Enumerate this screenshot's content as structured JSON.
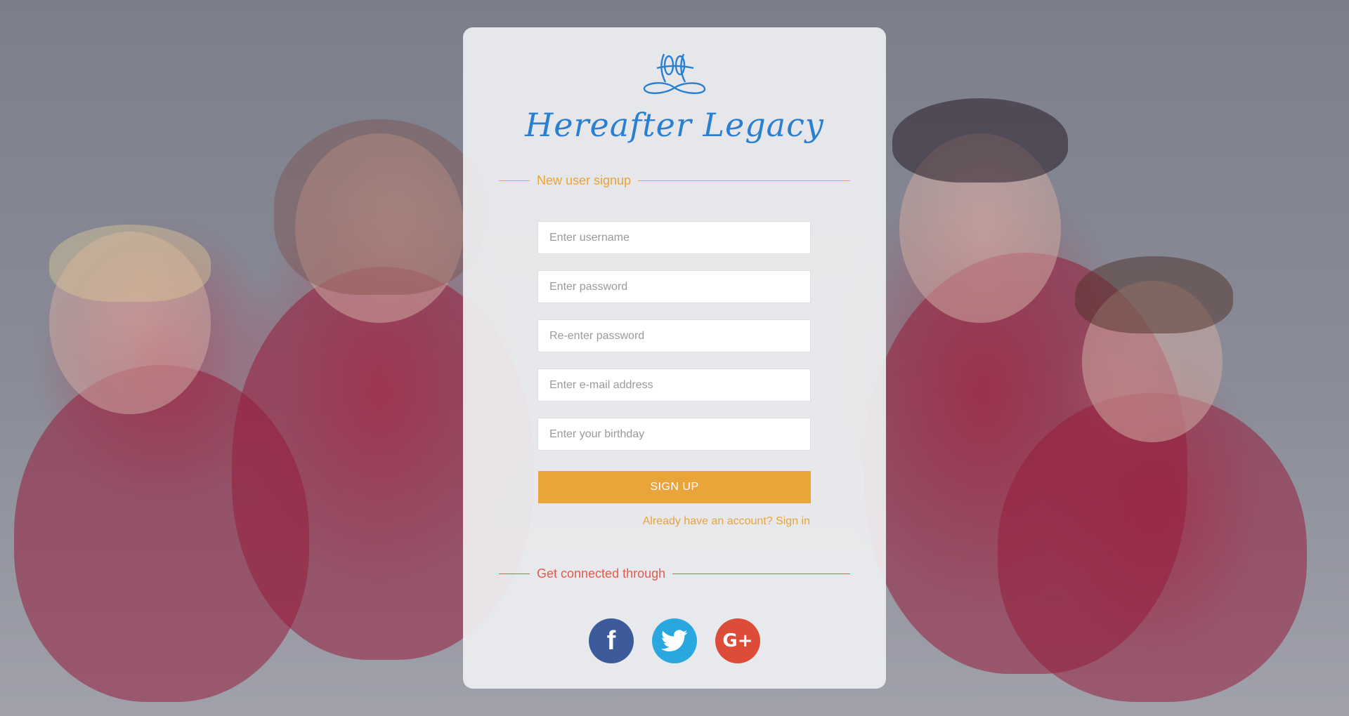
{
  "brand": {
    "name": "Hereafter Legacy",
    "color": "#2a7fd0"
  },
  "signup": {
    "heading": "New user signup",
    "fields": {
      "username_placeholder": "Enter username",
      "password_placeholder": "Enter password",
      "repassword_placeholder": "Re-enter password",
      "email_placeholder": "Enter e-mail address",
      "birthday_placeholder": "Enter your birthday"
    },
    "submit_label": "SIGN UP",
    "signin_link": "Already have an account? Sign in"
  },
  "social": {
    "heading": "Get connected through",
    "items": [
      {
        "name": "facebook",
        "icon": "facebook-icon",
        "glyph": "f",
        "color": "#3d5a9a"
      },
      {
        "name": "twitter",
        "icon": "twitter-icon",
        "glyph": "",
        "color": "#2aa7df"
      },
      {
        "name": "google-plus",
        "icon": "google-plus-icon",
        "glyph": "G+",
        "color": "#dd4b39"
      }
    ]
  },
  "colors": {
    "accent": "#e9a43a",
    "social_accent": "#e45a4a"
  }
}
